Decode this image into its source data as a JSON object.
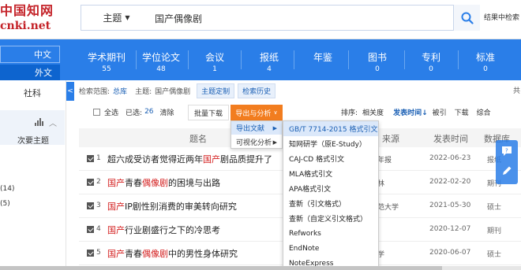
{
  "logo": {
    "line1": "中国知网",
    "line2": "cnki.net"
  },
  "search": {
    "field": "主题",
    "query": "国产偶像剧",
    "in_results": "结果中检索"
  },
  "lang": {
    "zh": "中文",
    "en": "外文"
  },
  "nav": [
    {
      "label": "学术期刊",
      "count": "55"
    },
    {
      "label": "学位论文",
      "count": "48"
    },
    {
      "label": "会议",
      "count": "1"
    },
    {
      "label": "报纸",
      "count": "4"
    },
    {
      "label": "年鉴",
      "count": ""
    },
    {
      "label": "图书",
      "count": "0"
    },
    {
      "label": "专利",
      "count": "0"
    },
    {
      "label": "标准",
      "count": "0"
    }
  ],
  "left": {
    "tab": "社科",
    "sub": "次要主题",
    "counts": [
      "(14)",
      "(5)"
    ]
  },
  "scope": {
    "label": "检索范围:",
    "value": "总库",
    "topic_label": "主题:",
    "topic_value": "国产偶像剧",
    "btn_custom": "主题定制",
    "btn_history": "检索历史",
    "right_hint": "共"
  },
  "tools": {
    "select_all": "全选",
    "selected_label": "已选:",
    "selected_count": "26",
    "clear": "清除",
    "batch_download": "批量下载",
    "export": "导出与分析",
    "sort_label": "排序:",
    "sort_options": [
      "相关度",
      "发表时间",
      "被引",
      "下载",
      "综合"
    ],
    "sort_active": "发表时间"
  },
  "table": {
    "headers": [
      "题名",
      "来源",
      "发表时间",
      "数据库"
    ],
    "rows": [
      {
        "n": "1",
        "pre": "超六成受访者觉得近两年",
        "hl": "国产",
        "post": "剧品质提升了",
        "source": "年报",
        "date": "2022-06-23",
        "db": "报纸"
      },
      {
        "n": "2",
        "pre": "",
        "hl": "国产",
        "mid": "青春",
        "hl2": "偶像剧",
        "post": "的困境与出路",
        "source": "林",
        "date": "2022-02-20",
        "db": "期刊"
      },
      {
        "n": "3",
        "pre": "",
        "hl": "国产",
        "post": "IP剧性别消费的审美转向研究",
        "source": "范大学",
        "date": "2021-05-30",
        "db": "硕士"
      },
      {
        "n": "4",
        "pre": "",
        "hl": "国产",
        "post": "行业剧盛行之下的冷思考",
        "source": "",
        "date": "2020-12-07",
        "db": "期刊"
      },
      {
        "n": "5",
        "pre": "",
        "hl": "国产",
        "mid": "青春",
        "hl2": "偶像剧",
        "post": "中的男性身体研究",
        "source": "学",
        "date": "2020-06-07",
        "db": "硕士"
      }
    ]
  },
  "export_menu": [
    {
      "label": "导出文献",
      "arrow": "▶"
    },
    {
      "label": "可视化分析",
      "arrow": "▶"
    }
  ],
  "cite_menu": [
    "GB/T 7714-2015 格式引文",
    "知网研学（原E-Study）",
    "CAJ-CD 格式引文",
    "MLA格式引文",
    "APA格式引文",
    "查新（引文格式）",
    "查新（自定义引文格式）",
    "Refworks",
    "EndNote",
    "NoteExpress"
  ],
  "colors": {
    "brand_blue": "#2a7ee8",
    "export_orange": "#f27d1f",
    "highlight_red": "#d42020",
    "logo_red": "#c42228"
  }
}
